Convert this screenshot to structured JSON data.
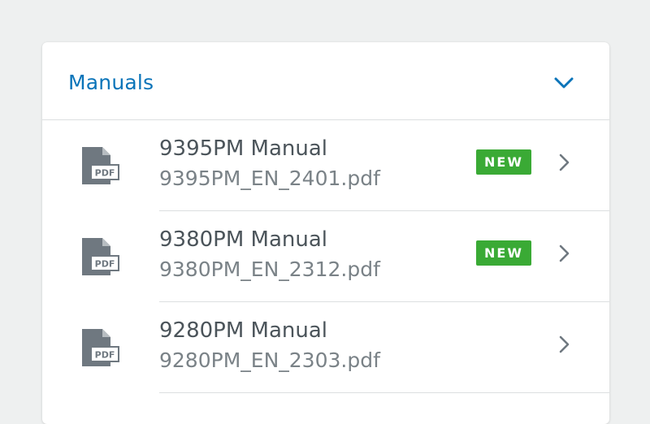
{
  "panel": {
    "title": "Manuals",
    "collapse_icon": "chevron-down-icon",
    "accent_color": "#0a74b9"
  },
  "documents": [
    {
      "title": "9395PM Manual",
      "filename": "9395PM_EN_2401.pdf",
      "icon": "pdf-file-icon",
      "file_icon_label": "PDF",
      "badge": "NEW"
    },
    {
      "title": "9380PM Manual",
      "filename": "9380PM_EN_2312.pdf",
      "icon": "pdf-file-icon",
      "file_icon_label": "PDF",
      "badge": "NEW"
    },
    {
      "title": "9280PM Manual",
      "filename": "9280PM_EN_2303.pdf",
      "icon": "pdf-file-icon",
      "file_icon_label": "PDF",
      "badge": null
    }
  ],
  "badge_color": "#3aaa35",
  "row_arrow_icon": "chevron-right-icon"
}
